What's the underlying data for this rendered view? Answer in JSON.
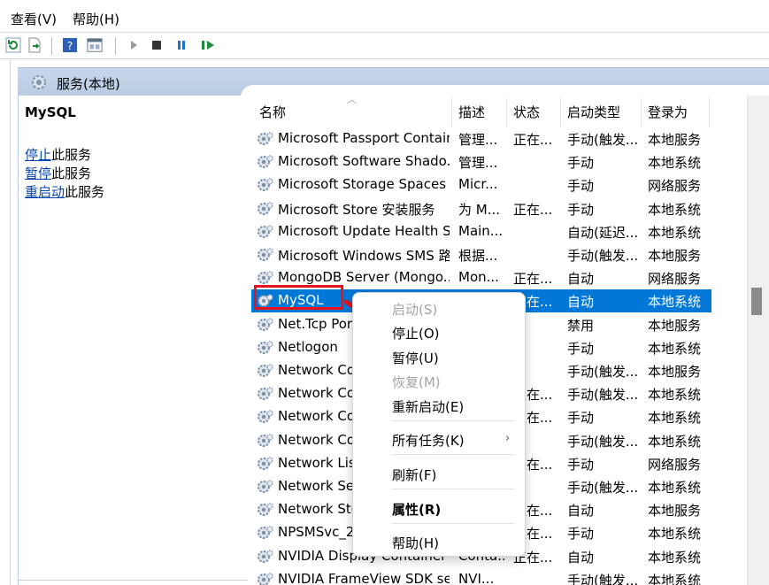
{
  "menubar": {
    "view": "查看(V)",
    "help": "帮助(H)"
  },
  "pane": {
    "title": "服务(本地)"
  },
  "extended": {
    "service_name": "MySQL",
    "actions": [
      {
        "link": "停止",
        "rest": "此服务"
      },
      {
        "link": "暂停",
        "rest": "此服务"
      },
      {
        "link": "重启动",
        "rest": "此服务"
      }
    ]
  },
  "columns": [
    "名称",
    "描述",
    "状态",
    "启动类型",
    "登录为"
  ],
  "rows": [
    {
      "name": "Microsoft Passport Container",
      "desc": "管理...",
      "status": "正在...",
      "startup": "手动(触发...",
      "logon": "本地服务"
    },
    {
      "name": "Microsoft Software Shado...",
      "desc": "管理...",
      "status": "",
      "startup": "手动",
      "logon": "本地系统"
    },
    {
      "name": "Microsoft Storage Spaces S...",
      "desc": "Micr...",
      "status": "",
      "startup": "手动",
      "logon": "网络服务"
    },
    {
      "name": "Microsoft Store 安装服务",
      "desc": "为 M...",
      "status": "正在...",
      "startup": "手动",
      "logon": "本地系统"
    },
    {
      "name": "Microsoft Update Health S...",
      "desc": "Main...",
      "status": "",
      "startup": "自动(延迟...",
      "logon": "本地系统"
    },
    {
      "name": "Microsoft Windows SMS 路...",
      "desc": "根据...",
      "status": "",
      "startup": "手动(触发...",
      "logon": "本地服务"
    },
    {
      "name": "MongoDB Server (Mongo...",
      "desc": "Mon...",
      "status": "正在...",
      "startup": "自动",
      "logon": "网络服务"
    },
    {
      "name": "MySQL",
      "desc": "",
      "status": "正在...",
      "startup": "自动",
      "logon": "本地系统"
    },
    {
      "name": "Net.Tcp Port Sharing Service",
      "desc": "",
      "status": "",
      "startup": "禁用",
      "logon": "本地服务"
    },
    {
      "name": "Netlogon",
      "desc": "",
      "status": "",
      "startup": "手动",
      "logon": "本地系统"
    },
    {
      "name": "Network Connected Devices",
      "desc": "",
      "status": "",
      "startup": "手动(触发...",
      "logon": "本地服务"
    },
    {
      "name": "Network Connection Broker",
      "desc": "",
      "status": "正在...",
      "startup": "手动(触发...",
      "logon": "本地系统"
    },
    {
      "name": "Network Connections",
      "desc": "",
      "status": "正在...",
      "startup": "手动",
      "logon": "本地系统"
    },
    {
      "name": "Network Connectivity Assis",
      "desc": "",
      "status": "",
      "startup": "手动(触发...",
      "logon": "本地系统"
    },
    {
      "name": "Network List Service",
      "desc": "",
      "status": "正在...",
      "startup": "手动",
      "logon": "网络服务"
    },
    {
      "name": "Network Setup Service",
      "desc": "",
      "status": "",
      "startup": "手动(触发...",
      "logon": "本地系统"
    },
    {
      "name": "Network Store Interface",
      "desc": "",
      "status": "正在...",
      "startup": "自动",
      "logon": "本地服务"
    },
    {
      "name": "NPSMSvc_2",
      "desc": "",
      "status": "正在...",
      "startup": "手动",
      "logon": "本地系统"
    },
    {
      "name": "NVIDIA Display Container LS",
      "desc": "Conta...",
      "status": "正在...",
      "startup": "自动",
      "logon": "本地系统"
    },
    {
      "name": "NVIDIA FrameView SDK se...",
      "desc": "NVI...",
      "status": "",
      "startup": "手动(触发...",
      "logon": "本地系统"
    }
  ],
  "selected_row": 7,
  "context_menu": {
    "start": "启动(S)",
    "stop": "停止(O)",
    "pause": "暂停(U)",
    "resume": "恢复(M)",
    "restart": "重新启动(E)",
    "all_tasks": "所有任务(K)",
    "refresh": "刷新(F)",
    "properties": "属性(R)",
    "help": "帮助(H)"
  },
  "colors": {
    "selection": "#0078d7",
    "highlight_box": "#e5141c",
    "header_band": "#c6d7ea",
    "link": "#0645ad"
  }
}
